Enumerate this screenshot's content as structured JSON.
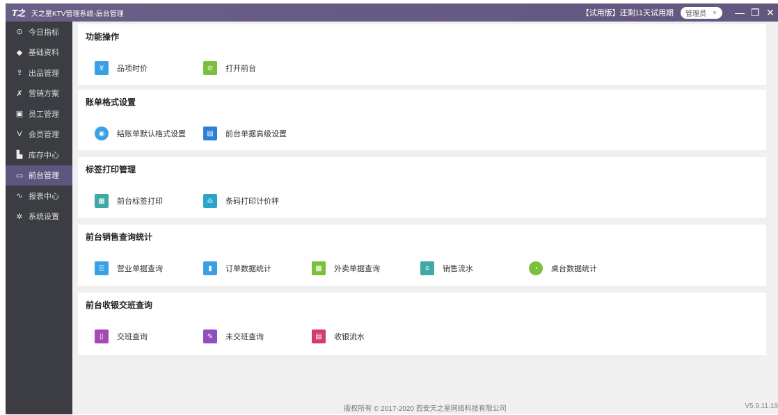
{
  "titlebar": {
    "logo": "T之",
    "title": "天之星KTV管理系统-后台管理",
    "trial_text": "【试用版】还剩11天试用期",
    "role": "管理员",
    "minimize": "—",
    "restore": "❐",
    "close": "✕"
  },
  "sidebar": {
    "items": [
      {
        "label": "今日指标",
        "icon": "⊙"
      },
      {
        "label": "基础资料",
        "icon": "◆"
      },
      {
        "label": "出品管理",
        "icon": "⇪"
      },
      {
        "label": "营销方案",
        "icon": "✗"
      },
      {
        "label": "员工管理",
        "icon": "▣"
      },
      {
        "label": "会员管理",
        "icon": "V"
      },
      {
        "label": "库存中心",
        "icon": "▙"
      },
      {
        "label": "前台管理",
        "icon": "▭"
      },
      {
        "label": "报表中心",
        "icon": "∿"
      },
      {
        "label": "系统设置",
        "icon": "✲"
      }
    ]
  },
  "sections": [
    {
      "title": "功能操作",
      "tiles": [
        {
          "label": "品项时价",
          "color": "#3aa0e6"
        },
        {
          "label": "打开前台",
          "color": "#7cbf3b"
        }
      ]
    },
    {
      "title": "账单格式设置",
      "tiles": [
        {
          "label": "结账单默认格式设置",
          "color": "#3aa0e6"
        },
        {
          "label": "前台单据高级设置",
          "color": "#2e7fd8"
        }
      ]
    },
    {
      "title": "标签打印管理",
      "tiles": [
        {
          "label": "前台标签打印",
          "color": "#3fa9a6"
        },
        {
          "label": "条码打印计价秤",
          "color": "#2aa5c9"
        }
      ]
    },
    {
      "title": "前台销售查询统计",
      "tiles": [
        {
          "label": "营业单据查询",
          "color": "#3aa0e6"
        },
        {
          "label": "订单数据统计",
          "color": "#3aa0e6"
        },
        {
          "label": "外卖单据查询",
          "color": "#7cbf3b"
        },
        {
          "label": "销售流水",
          "color": "#3fa9a6"
        },
        {
          "label": "桌台数据统计",
          "color": "#7cbf3b"
        }
      ]
    },
    {
      "title": "前台收银交班查询",
      "tiles": [
        {
          "label": "交班查询",
          "color": "#a34ab5"
        },
        {
          "label": "未交班查询",
          "color": "#8e4fc1"
        },
        {
          "label": "收银流水",
          "color": "#d33a6e"
        }
      ]
    }
  ],
  "footer": {
    "copyright": "版权所有 © 2017-2020 西安天之星网络科技有限公司",
    "version": "V5.9.11.19"
  },
  "active_nav_index": 7
}
